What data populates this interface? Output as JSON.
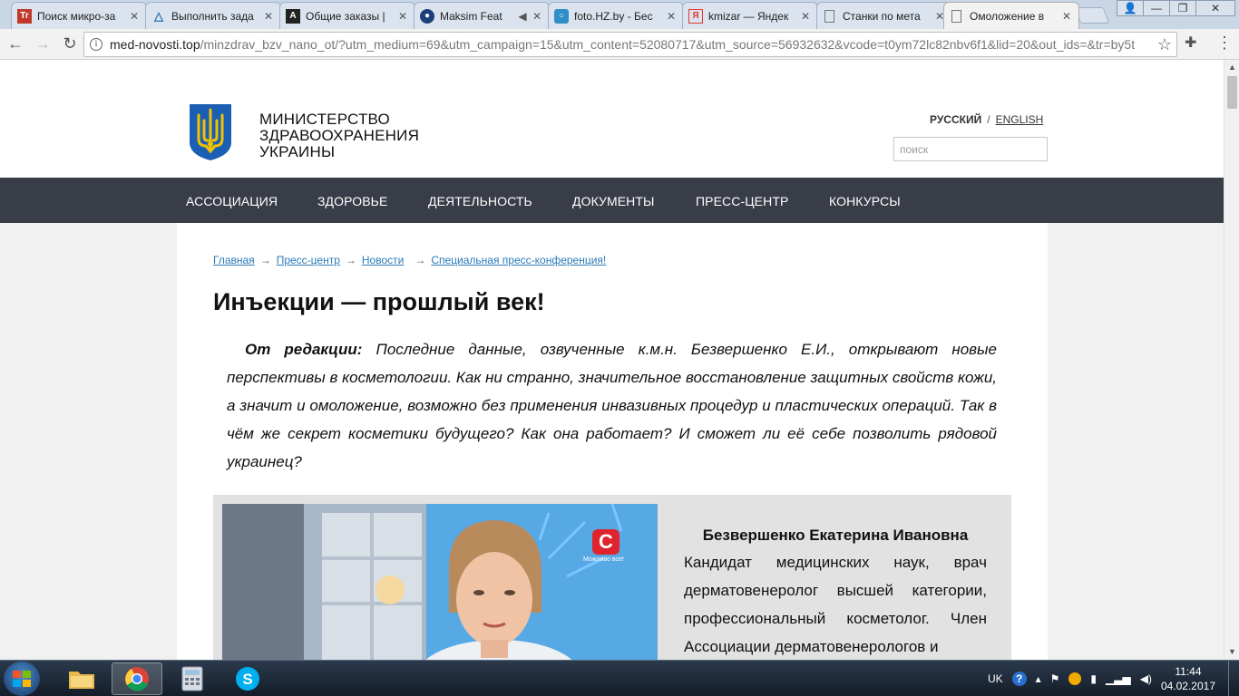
{
  "browser": {
    "tabs": [
      {
        "title": "Поиск микро-за",
        "icon": "tt-icon",
        "icon_color": "#c0392b"
      },
      {
        "title": "Выполнить зада",
        "icon": "triangle-icon",
        "icon_color": "#2a6fb0"
      },
      {
        "title": "Общие заказы |",
        "icon": "a-icon",
        "icon_color": "#222222"
      },
      {
        "title": "Maksim Feat",
        "icon": "globe-icon",
        "icon_color": "#1d3f7a"
      },
      {
        "title": "foto.HZ.by - Бес",
        "icon": "photo-icon",
        "icon_color": "#2e8ec7"
      },
      {
        "title": "kmizar — Яндек",
        "icon": "yandex-icon",
        "icon_color": "#e53935"
      },
      {
        "title": "Станки по мета",
        "icon": "page-icon",
        "icon_color": "#777777"
      },
      {
        "title": "Омоложение в",
        "icon": "page-icon",
        "icon_color": "#777777"
      }
    ],
    "url_host": "med-novosti.top",
    "url_rest": "/minzdrav_bzv_nano_ot/?utm_medium=69&utm_campaign=15&utm_content=52080717&utm_source=56932632&vcode=t0ym72lc82nbv6f1&lid=20&out_ids=&tr=by5t"
  },
  "site": {
    "ministry_lines": [
      "МИНИСТЕРСТВО",
      "ЗДРАВООХРАНЕНИЯ",
      "УКРАИНЫ"
    ],
    "lang_ru": "РУССКИЙ",
    "lang_sep": "/",
    "lang_en": "ENGLISH",
    "search_placeholder": "поиск",
    "nav": [
      "АССОЦИАЦИЯ",
      "ЗДОРОВЬЕ",
      "ДЕЯТЕЛЬНОСТЬ",
      "ДОКУМЕНТЫ",
      "ПРЕСС-ЦЕНТР",
      "КОНКУРСЫ"
    ],
    "breadcrumbs": [
      "Главная",
      "Пресс-центр",
      "Новости",
      "Специальная пресс-конференция!"
    ],
    "breadcrumb_arrow": "→",
    "title": "Инъекции — прошлый век!",
    "lead_label": "От редакции:",
    "lead_text": "Последние данные, озвученные к.м.н. Безвершенко Е.И., открывают новые перспективы в косметологии. Как ни странно, значительное восстановление защитных свойств кожи, а значит и омоложение, возможно без применения инвазивных процедур и пластических операций. Так в чём же секрет косметики будущего? Как она работает? И сможет ли её себе позволить рядовой украинец?",
    "profile_name": "Безвершенко Екатерина Ивановна",
    "profile_bio": "Кандидат медицинских наук, врач дерматовенеролог высшей категории, профессиональный косметолог. Член Ассоциации дерматовенерологов и",
    "tv_logo": "С",
    "tv_slogan": "Можливо все!"
  },
  "taskbar": {
    "lang": "UK",
    "time": "11:44",
    "date": "04.02.2017"
  },
  "colors": {
    "nav_bg": "#383d47",
    "link": "#2a7ab8",
    "profile_bg": "#e2e2e2",
    "tv_logo_red": "#e0242d"
  }
}
